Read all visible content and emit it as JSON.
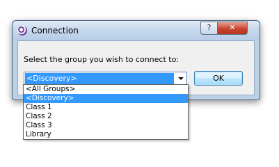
{
  "window": {
    "title": "Connection",
    "help_label": "?",
    "close_label": "✕"
  },
  "prompt": "Select the group you wish to connect to:",
  "combo": {
    "selected": "<Discovery>",
    "options": [
      "<All Groups>",
      "<Discovery>",
      "Class 1",
      "Class 2",
      "Class 3",
      "Library"
    ],
    "selected_index": 1
  },
  "ok_label": "OK",
  "icons": {
    "app": "connection-app-icon",
    "help": "help-icon",
    "close": "close-icon",
    "dropdown": "chevron-down-icon"
  },
  "colors": {
    "selection": "#3399ff",
    "close_button": "#c7442f",
    "frame": "#bcd0e6"
  }
}
